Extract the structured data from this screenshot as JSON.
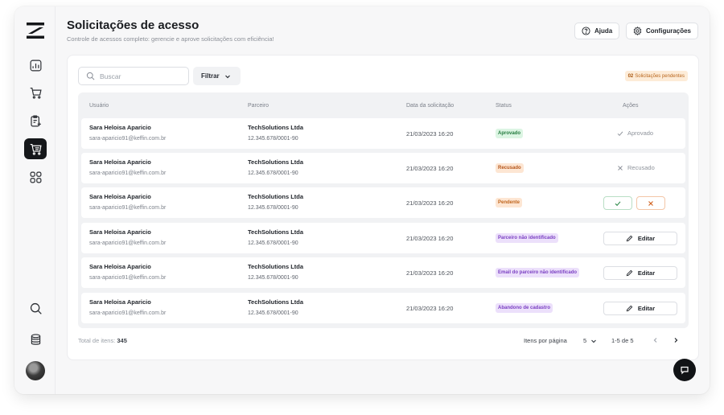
{
  "header": {
    "title": "Solicitações de acesso",
    "subtitle": "Controle de acessos completo: gerencie e aprove solicitações com eficiência!",
    "help_label": "Ajuda",
    "settings_label": "Configurações"
  },
  "toolbar": {
    "search_placeholder": "Buscar",
    "filter_label": "Filtrar",
    "pending_count": "02",
    "pending_text": "Solicitações pendentes"
  },
  "table": {
    "columns": [
      "Usuário",
      "Parceiro",
      "Data da solicitação",
      "Status",
      "Ações"
    ],
    "rows": [
      {
        "name": "Sara Heloisa Aparicio",
        "email": "sara-aparicio91@keffin.com.br",
        "partner": "TechSolutions Ltda",
        "cnpj": "12.345.678/0001-90",
        "date": "21/03/2023 16:20",
        "status": "Aprovado",
        "action": "Aprovado"
      },
      {
        "name": "Sara Heloisa Aparicio",
        "email": "sara-aparicio91@keffin.com.br",
        "partner": "TechSolutions Ltda",
        "cnpj": "12.345.678/0001-90",
        "date": "21/03/2023 16:20",
        "status": "Recusado",
        "action": "Recusado"
      },
      {
        "name": "Sara Heloisa Aparicio",
        "email": "sara-aparicio91@keffin.com.br",
        "partner": "TechSolutions Ltda",
        "cnpj": "12.345.678/0001-90",
        "date": "21/03/2023 16:20",
        "status": "Pendente",
        "action": ""
      },
      {
        "name": "Sara Heloisa Aparicio",
        "email": "sara-aparicio91@keffin.com.br",
        "partner": "TechSolutions Ltda",
        "cnpj": "12.345.678/0001-90",
        "date": "21/03/2023 16:20",
        "status": "Parceiro não identificado",
        "action": "Editar"
      },
      {
        "name": "Sara Heloisa Aparicio",
        "email": "sara-aparicio91@keffin.com.br",
        "partner": "TechSolutions Ltda",
        "cnpj": "12.345.678/0001-90",
        "date": "21/03/2023 16:20",
        "status": "Email do parceiro não identificado",
        "action": "Editar"
      },
      {
        "name": "Sara Heloisa Aparicio",
        "email": "sara-aparicio91@keffin.com.br",
        "partner": "TechSolutions Ltda",
        "cnpj": "12.345.678/0001-90",
        "date": "21/03/2023 16:20",
        "status": "Abandono de cadastro",
        "action": "Editar"
      }
    ]
  },
  "footer": {
    "total_label": "Total de itens:",
    "total_value": "345",
    "per_page_label": "Itens por página",
    "per_page_value": "5",
    "range": "1-5 de 5"
  },
  "sidebar": {
    "items": [
      "dashboard-icon",
      "cart-icon",
      "clipboard-add-icon",
      "cart-list-icon",
      "grid-icon"
    ],
    "bottom": [
      "search-icon",
      "database-icon"
    ]
  },
  "colors": {
    "accent_dark": "#15171a",
    "approved_bg": "#dcf5e3",
    "declined_bg": "#fde6d3",
    "purple_bg": "#ece0fb"
  }
}
